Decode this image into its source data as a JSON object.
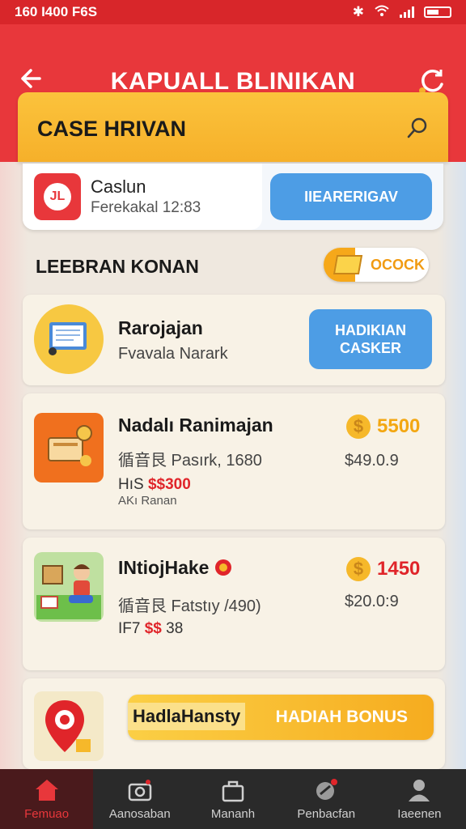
{
  "status_bar": {
    "time": "160 I400",
    "extra": "F6S"
  },
  "header": {
    "title": "KAPUALL BLINIKAN"
  },
  "daily_banner": {
    "title": "CASE HRIVAN"
  },
  "cash_card": {
    "name": "Caslun",
    "subtitle": "Ferekakal 12:83",
    "button": "IIEARERIGAV"
  },
  "section": {
    "title": "LEEBRAN KONAN",
    "coin_label": "OCOCK"
  },
  "tasks": [
    {
      "title": "Rarojajan",
      "subtitle": "Fvavala Narark",
      "button": "HADIKIAN CASKER"
    },
    {
      "title": "Nadalı Ranimajan",
      "line2": "循音艮 Pasırk, 1680",
      "line3_prefix": "HıS",
      "line3_value": "$$300",
      "line4": "AKı Ranan",
      "reward": "5500",
      "price": "$49.0.9"
    },
    {
      "title": "INtiojHake",
      "line2": "循音艮 Fatstıy /490)",
      "line3_prefix": "ІF7",
      "line3_value": "$$",
      "line3_suffix": "38",
      "reward": "1450",
      "price": "$20.0:9"
    }
  ],
  "bonus": {
    "left_label": "HadlaHansty",
    "right_label": "HADIAH BONUS"
  },
  "bottom_nav": [
    {
      "label": "Femuao",
      "icon": "home-icon"
    },
    {
      "label": "Aanosaban",
      "icon": "camera-icon"
    },
    {
      "label": "Mananh",
      "icon": "bag-icon"
    },
    {
      "label": "Penbacfan",
      "icon": "tag-icon"
    },
    {
      "label": "Iaeenen",
      "icon": "profile-icon"
    }
  ],
  "colors": {
    "primary_red": "#e8373b",
    "accent_yellow": "#f6b02a",
    "button_blue": "#4d9de5"
  }
}
